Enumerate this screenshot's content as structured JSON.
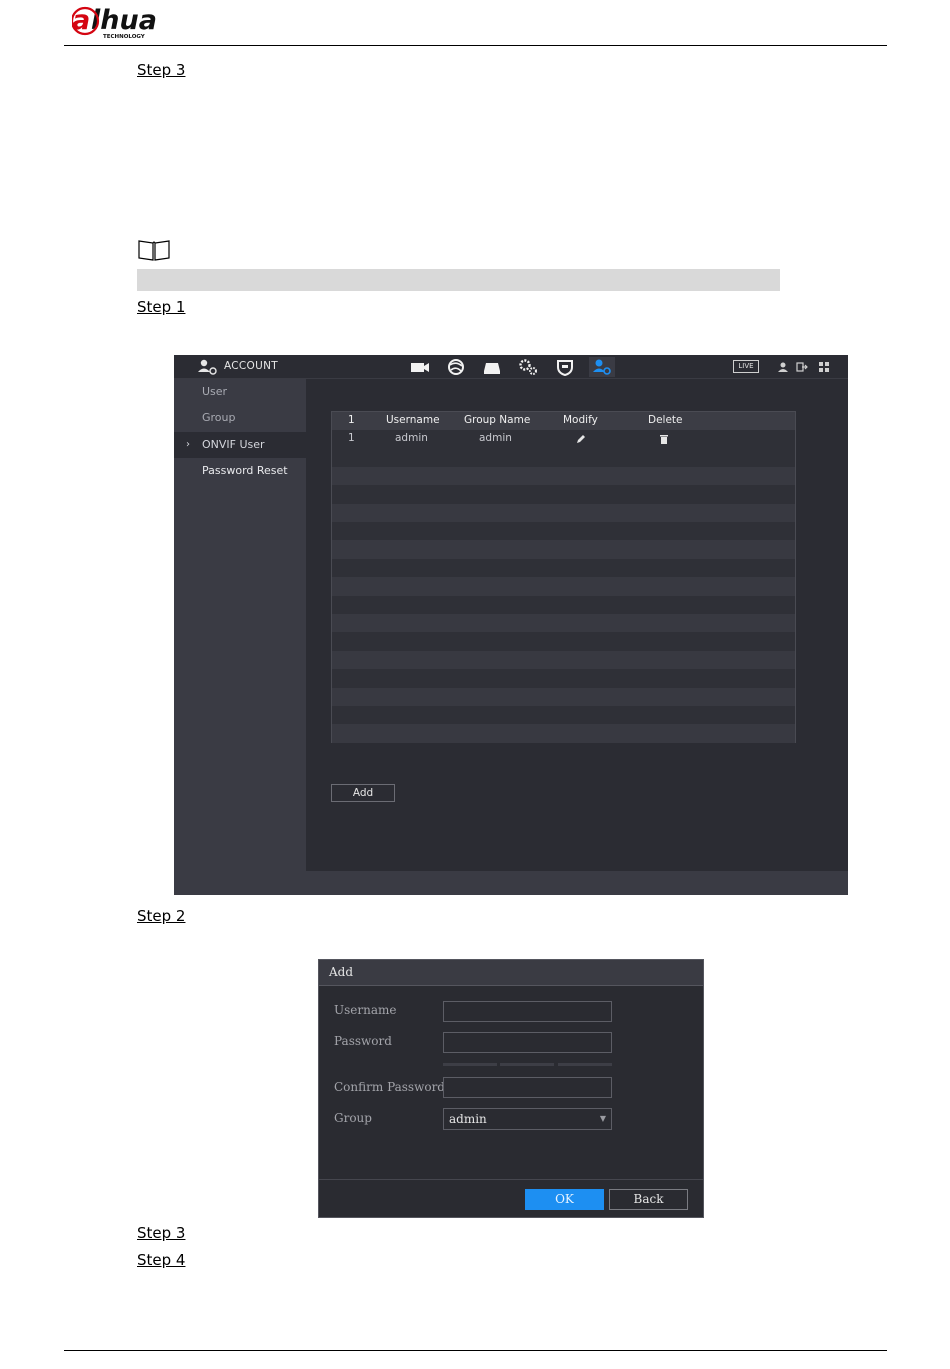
{
  "header": {
    "logo_alt": "alhua TECHNOLOGY"
  },
  "steps": {
    "s1": "Step 3",
    "s2": "Step 1",
    "s3": "Step 2",
    "s4": "Step 3",
    "s5": "Step 4"
  },
  "account": {
    "title": "ACCOUNT",
    "toolbar_icons": [
      "camera-icon",
      "network-icon",
      "storage-icon",
      "system-icon",
      "security-icon",
      "account-icon"
    ],
    "live_label": "LIVE",
    "sidebar": [
      {
        "label": "User"
      },
      {
        "label": "Group"
      },
      {
        "label": "ONVIF User",
        "active": true
      },
      {
        "label": "Password Reset"
      }
    ],
    "table": {
      "headers": [
        "1",
        "Username",
        "Group Name",
        "Modify",
        "Delete"
      ],
      "rows": [
        {
          "index": "1",
          "username": "admin",
          "group": "admin"
        }
      ]
    },
    "add_label": "Add"
  },
  "dialog": {
    "title": "Add",
    "fields": {
      "username": "Username",
      "password": "Password",
      "confirm": "Confirm Password",
      "group": "Group"
    },
    "group_value": "admin",
    "ok_label": "OK",
    "back_label": "Back"
  },
  "colors": {
    "panel_bg": "#2b2c33",
    "sidebar_bg": "#3a3b44",
    "accent": "#1d8ff2"
  }
}
